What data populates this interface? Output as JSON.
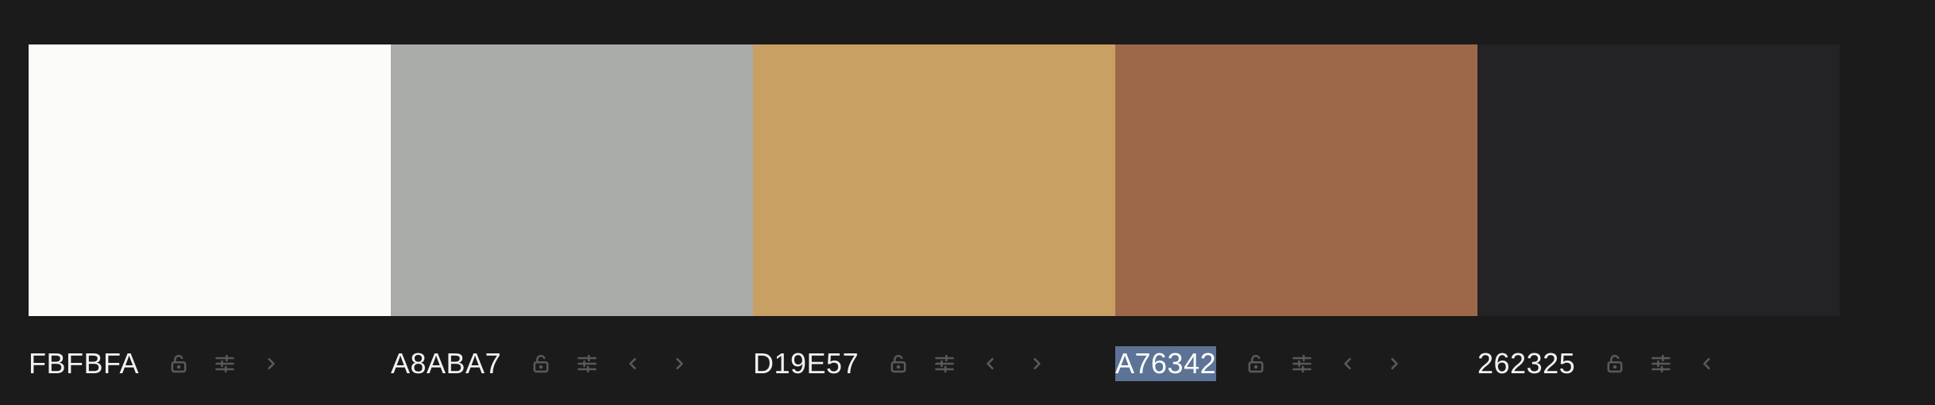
{
  "palette": [
    {
      "hex": "FBFBFA",
      "color": "#FBFBFA",
      "selected": false,
      "has_left": false,
      "has_right": true
    },
    {
      "hex": "A8ABA7",
      "color": "#A8ABA7",
      "selected": false,
      "has_left": true,
      "has_right": true
    },
    {
      "hex": "D19E57",
      "color": "#C9A063",
      "selected": false,
      "has_left": true,
      "has_right": true
    },
    {
      "hex": "A76342",
      "color": "#9D684A",
      "selected": true,
      "has_left": true,
      "has_right": true
    },
    {
      "hex": "262325",
      "color": "#232224",
      "selected": false,
      "has_left": true,
      "has_right": false
    }
  ],
  "icons": {
    "lock": "lock-icon",
    "adjust": "sliders-icon",
    "left": "chevron-left-icon",
    "right": "chevron-right-icon"
  },
  "colors": {
    "background": "#1B1B1B",
    "icon": "#5A5A5A",
    "text": "#F2F2F2",
    "selection": "#5C7396"
  }
}
